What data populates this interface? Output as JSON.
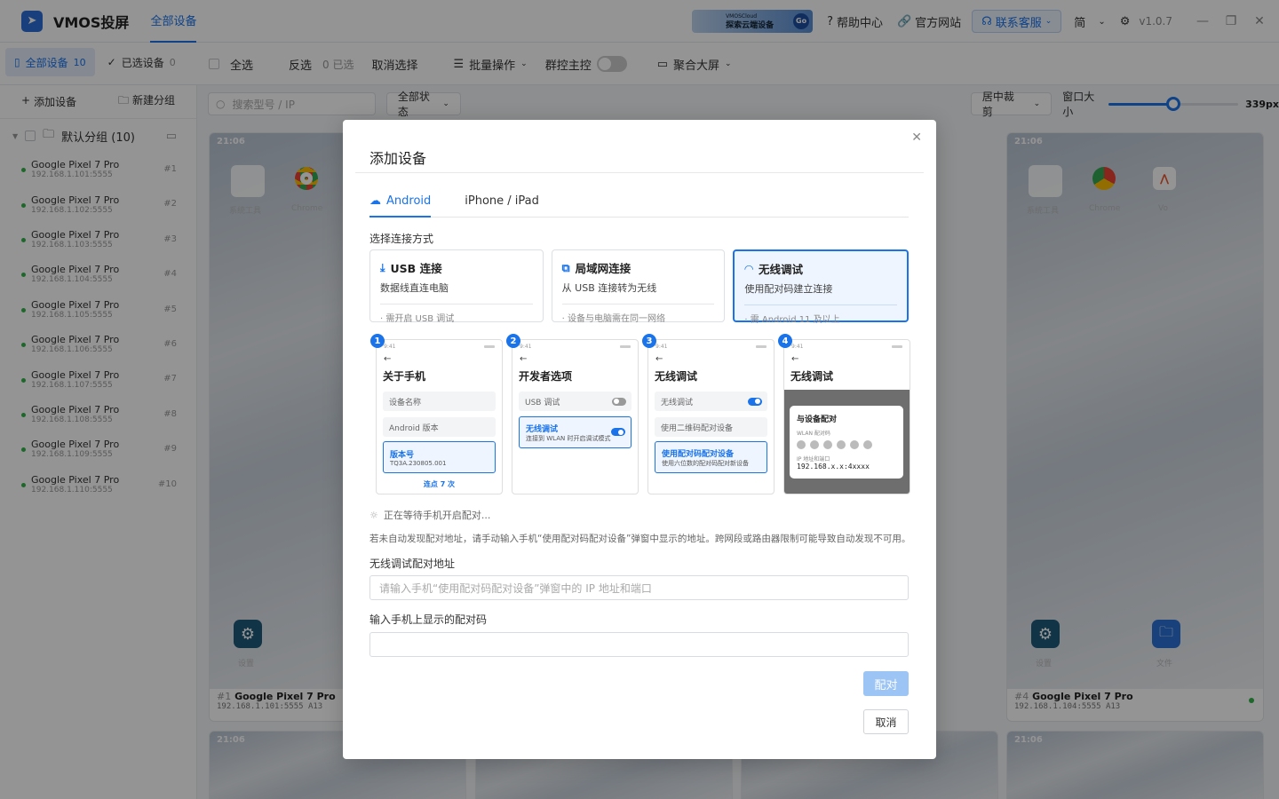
{
  "app": {
    "name": "VMOS投屏",
    "tab": "全部设备",
    "version": "v1.0.7",
    "lang": "简"
  },
  "header": {
    "cloud_banner_top": "VMOSCloud",
    "cloud_banner_main": "探索云端设备",
    "cloud_go": "Go",
    "help": "帮助中心",
    "website": "官方网站",
    "support": "联系客服"
  },
  "toolbar": {
    "all_devices": "全部设备",
    "all_count": "10",
    "selected_devices": "已选设备",
    "selected_count": "0",
    "select_all": "全选",
    "invert": "反选",
    "selected_info": "0 已选",
    "cancel_select": "取消选择",
    "batch": "批量操作",
    "group_control": "群控主控",
    "big_screen": "聚合大屏"
  },
  "sidebar": {
    "add_device": "添加设备",
    "new_group": "新建分组",
    "group_name": "默认分组 (10)",
    "devices": [
      {
        "name": "Google Pixel 7 Pro",
        "ip": "192.168.1.101:5555",
        "no": "#1"
      },
      {
        "name": "Google Pixel 7 Pro",
        "ip": "192.168.1.102:5555",
        "no": "#2"
      },
      {
        "name": "Google Pixel 7 Pro",
        "ip": "192.168.1.103:5555",
        "no": "#3"
      },
      {
        "name": "Google Pixel 7 Pro",
        "ip": "192.168.1.104:5555",
        "no": "#4"
      },
      {
        "name": "Google Pixel 7 Pro",
        "ip": "192.168.1.105:5555",
        "no": "#5"
      },
      {
        "name": "Google Pixel 7 Pro",
        "ip": "192.168.1.106:5555",
        "no": "#6"
      },
      {
        "name": "Google Pixel 7 Pro",
        "ip": "192.168.1.107:5555",
        "no": "#7"
      },
      {
        "name": "Google Pixel 7 Pro",
        "ip": "192.168.1.108:5555",
        "no": "#8"
      },
      {
        "name": "Google Pixel 7 Pro",
        "ip": "192.168.1.109:5555",
        "no": "#9"
      },
      {
        "name": "Google Pixel 7 Pro",
        "ip": "192.168.1.110:5555",
        "no": "#10"
      }
    ]
  },
  "filter": {
    "search_placeholder": "搜索型号 / IP",
    "status": "全部状态",
    "crop": "居中裁剪",
    "window_size_label": "窗口大小",
    "window_size": "339px",
    "slider_fraction": 0.5
  },
  "cards": [
    {
      "time": "21:06",
      "idx": "#1",
      "name": "Google Pixel 7 Pro",
      "ip": "192.168.1.101:5555 A13",
      "app1": "系统工具",
      "app2": "Chrome",
      "app3": "",
      "settings": "设置",
      "files": ""
    },
    {
      "time": "21:06",
      "idx": "#4",
      "name": "Google Pixel 7 Pro",
      "ip": "192.168.1.104:5555 A13",
      "app1": "系统工具",
      "app2": "Chrome",
      "app3": "Vo",
      "settings": "设置",
      "files": "文件"
    }
  ],
  "bottom_times": [
    "21:06",
    "21:06"
  ],
  "modal": {
    "title": "添加设备",
    "tab_android": "Android",
    "tab_ios": "iPhone / iPad",
    "method_label": "选择连接方式",
    "methods": [
      {
        "title": "USB 连接",
        "desc": "数据线直连电脑",
        "note": "需开启 USB 调试"
      },
      {
        "title": "局域网连接",
        "desc": "从 USB 连接转为无线",
        "note": "设备与电脑需在同一网络"
      },
      {
        "title": "无线调试",
        "desc": "使用配对码建立连接",
        "note": "需 Android 11 及以上"
      }
    ],
    "steps": [
      {
        "no": "1",
        "time": "9:41",
        "title": "关于手机",
        "r1": "设备名称",
        "r2": "Android 版本",
        "hl_title": "版本号",
        "hl_sub": "TQ3A.230805.001",
        "link": "连点 7 次"
      },
      {
        "no": "2",
        "time": "9:41",
        "title": "开发者选项",
        "r1": "USB 调试",
        "hl_title": "无线调试",
        "hl_sub": "连接到 WLAN 时开启调试模式"
      },
      {
        "no": "3",
        "time": "9:41",
        "title": "无线调试",
        "r1": "无线调试",
        "r2": "使用二维码配对设备",
        "hl_title": "使用配对码配对设备",
        "hl_sub": "使用六位数的配对码配对新设备"
      },
      {
        "no": "4",
        "time": "9:41",
        "title": "无线调试",
        "pop_title": "与设备配对",
        "pop_sub": "WLAN 配对码",
        "pop_addr_label": "IP 地址和端口",
        "pop_addr": "192.168.x.x:4xxxx"
      }
    ],
    "waiting": "正在等待手机开启配对...",
    "hint": "若未自动发现配对地址，请手动输入手机“使用配对码配对设备”弹窗中显示的地址。跨网段或路由器限制可能导致自动发现不可用。",
    "addr_label": "无线调试配对地址",
    "addr_placeholder": "请输入手机“使用配对码配对设备”弹窗中的 IP 地址和端口",
    "code_label": "输入手机上显示的配对码",
    "code_placeholder": "",
    "pair_btn": "配对",
    "cancel_btn": "取消"
  }
}
